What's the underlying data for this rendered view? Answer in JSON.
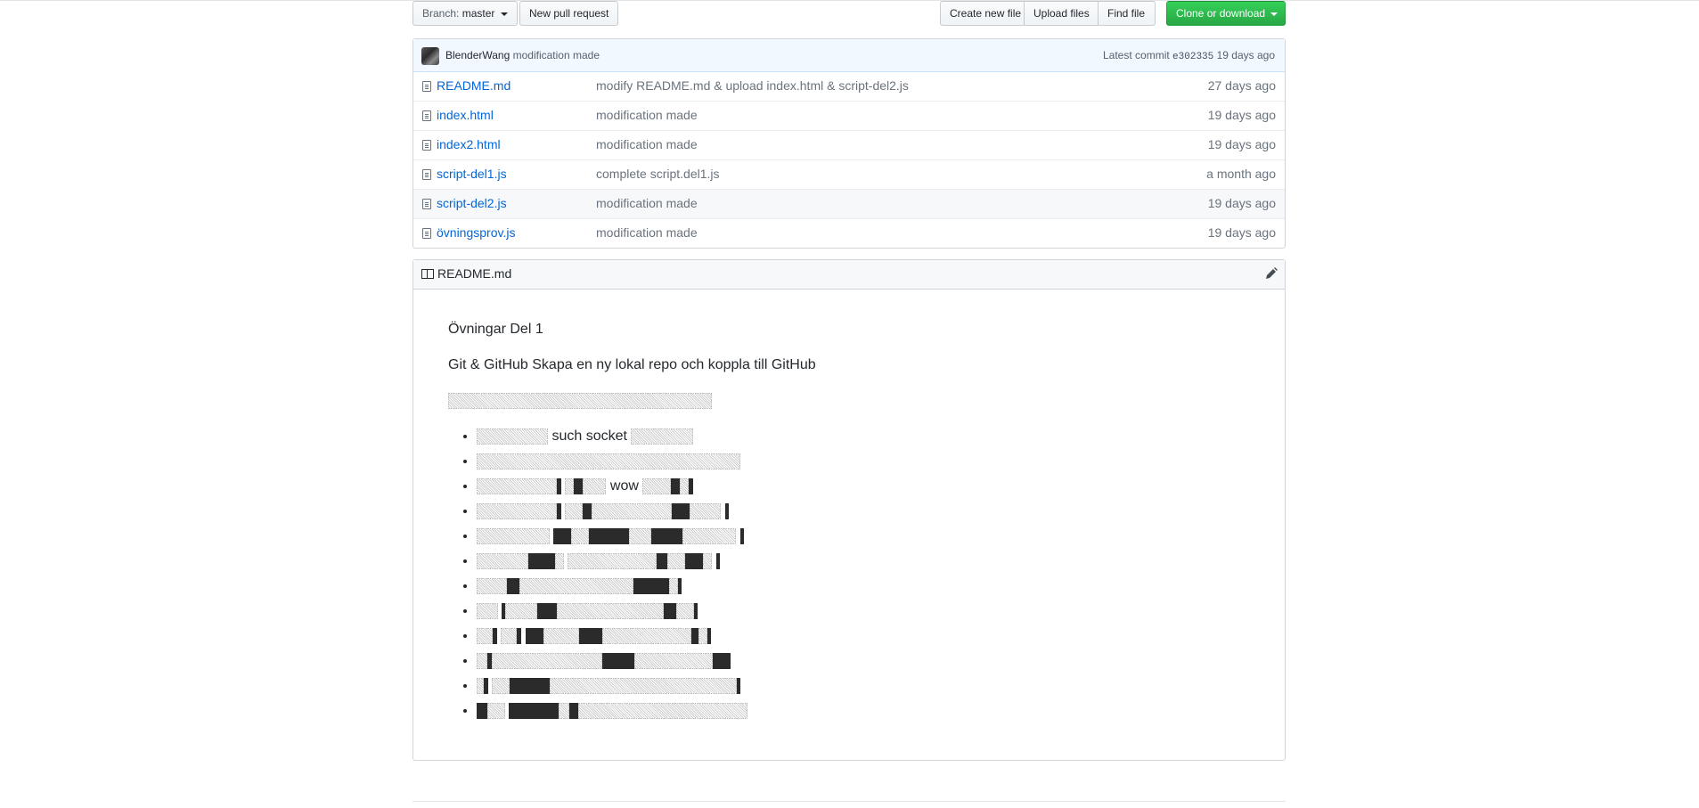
{
  "toolbar": {
    "branch_prefix": "Branch:",
    "branch_name": "master",
    "new_pull_request": "New pull request",
    "create_new_file": "Create new file",
    "upload_files": "Upload files",
    "find_file": "Find file",
    "clone_or_download": "Clone or download",
    "clone_color": "#28a745"
  },
  "commit": {
    "author": "BlenderWang",
    "message": "modification made",
    "latest_label": "Latest commit",
    "sha": "e302335",
    "age": "19 days ago"
  },
  "files": [
    {
      "name": "README.md",
      "message": "modify README.md & upload index.html & script-del2.js",
      "age": "27 days ago"
    },
    {
      "name": "index.html",
      "message": "modification made",
      "age": "19 days ago"
    },
    {
      "name": "index2.html",
      "message": "modification made",
      "age": "19 days ago"
    },
    {
      "name": "script-del1.js",
      "message": "complete script.del1.js",
      "age": "a month ago"
    },
    {
      "name": "script-del2.js",
      "message": "modification made",
      "age": "19 days ago"
    },
    {
      "name": "övningsprov.js",
      "message": "modification made",
      "age": "19 days ago"
    }
  ],
  "readme": {
    "header_title": "README.md",
    "heading1": "Övningar Del 1",
    "heading2": "Git & GitHub Skapa en ny lokal repo och koppla till GitHub",
    "list_words": {
      "item1": "such socket",
      "item3": "wow"
    }
  },
  "icons": {
    "file": "file-icon",
    "book": "book-icon",
    "edit": "pencil-icon",
    "avatar": "user-avatar"
  },
  "colors": {
    "link": "#0366d6",
    "commit_bg": "#f1f8ff",
    "muted": "#6a737d"
  }
}
